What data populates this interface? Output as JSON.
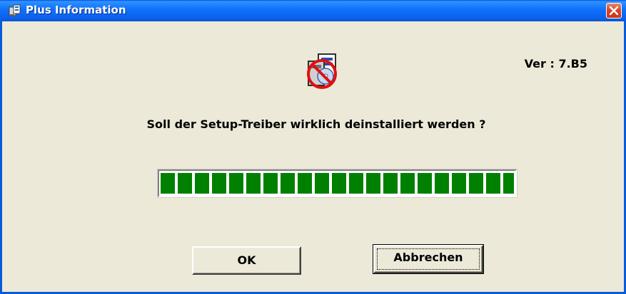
{
  "window": {
    "title": "Plus Information",
    "close_icon": "close-x-icon",
    "title_icon": "setup-driver-icon"
  },
  "content": {
    "version": "Ver : 7.B5",
    "question": "Soll der Setup-Treiber wirklich deinstalliert werden ?",
    "main_icon": "uninstall-driver-icon",
    "progress": {
      "segments_visible": 20,
      "fill_fraction": 1.0,
      "color": "#008000"
    }
  },
  "buttons": {
    "ok": "OK",
    "cancel": "Abbrechen"
  },
  "colors": {
    "titlebar": "#0c66f5",
    "dialog_bg": "#ece9d8",
    "progress": "#008000",
    "close_button": "#d9472a"
  }
}
